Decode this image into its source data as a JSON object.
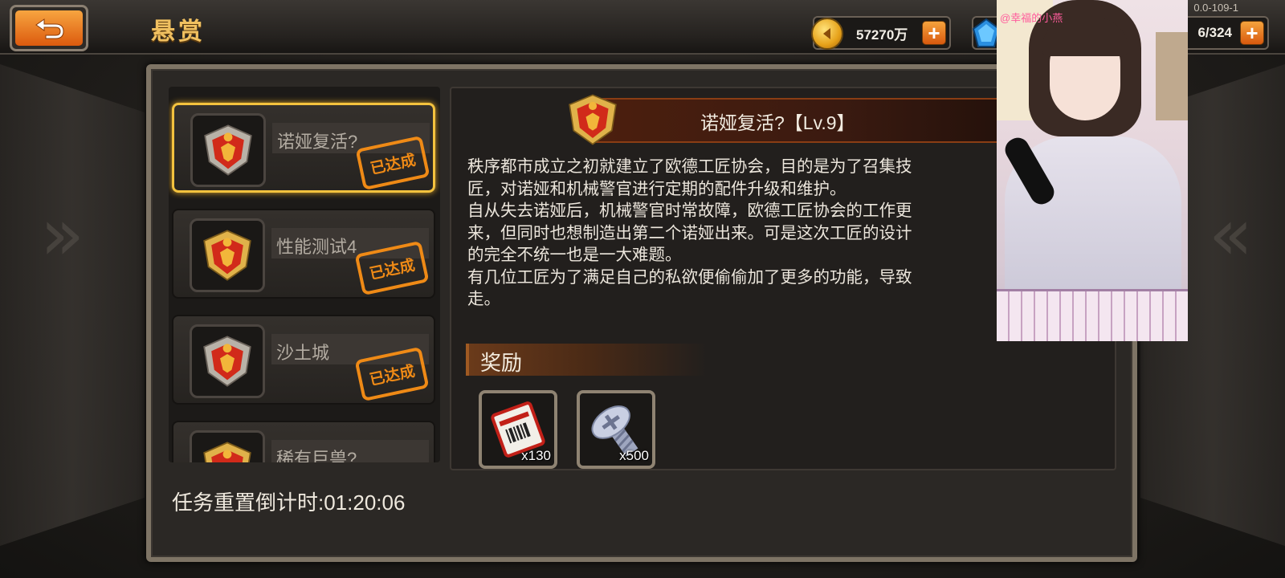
{
  "header": {
    "title": "悬赏",
    "version": "0.0-109-1",
    "currencies": [
      {
        "name": "coin",
        "value": "57270万"
      },
      {
        "name": "gem",
        "value": "6/324"
      }
    ]
  },
  "tasks": [
    {
      "name": "诺娅复活?",
      "status": "已达成",
      "selected": true
    },
    {
      "name": "性能测试4",
      "status": "已达成",
      "selected": false
    },
    {
      "name": "沙土城",
      "status": "已达成",
      "selected": false
    },
    {
      "name": "稀有巨兽?",
      "status": "",
      "selected": false
    }
  ],
  "detail": {
    "title": "诺娅复活?【Lv.9】",
    "description": [
      "秩序都市成立之初就建立了欧德工匠协会，目的是为了召集技",
      "匠，对诺娅和机械警官进行定期的配件升级和维护。",
      "自从失去诺娅后，机械警官时常故障，欧德工匠协会的工作更",
      "来，但同时也想制造出第二个诺娅出来。可是这次工匠的设计",
      "的完全不统一也是一大难题。",
      "有几位工匠为了满足自己的私欲便偷偷加了更多的功能，导致",
      "走。"
    ],
    "reward_label": "奖励",
    "rewards": [
      {
        "icon": "ticket-icon",
        "quantity": "x130"
      },
      {
        "icon": "screw-icon",
        "quantity": "x500"
      }
    ]
  },
  "countdown": "任务重置倒计时:01:20:06",
  "overlay": {
    "name_tag": "@幸福的小燕"
  },
  "colors": {
    "accent_orange": "#ef8a16",
    "selection_gold": "#f3c23e",
    "title_gold": "#f0c060"
  }
}
